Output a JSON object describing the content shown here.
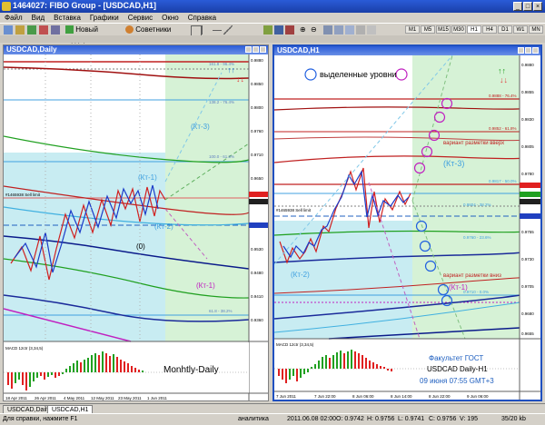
{
  "app": {
    "title": "1464027: FIBO Group - [USDCAD,H1]"
  },
  "menu": [
    "Файл",
    "Вид",
    "Вставка",
    "Графики",
    "Сервис",
    "Окно",
    "Справка"
  ],
  "toolbar": {
    "new_order": "Новый Ордер",
    "advisors": "Советники",
    "timeframes": [
      "M1",
      "M5",
      "M15",
      "M30",
      "H1",
      "H4",
      "D1",
      "W1",
      "MN"
    ]
  },
  "window_left": {
    "title": "USDCAD,Daily",
    "price_labels": [
      "0.9880",
      "0.9850",
      "0.9800",
      "0.9760",
      "0.9710",
      "0.9650",
      "0.9620",
      "0.9560",
      "0.9530",
      "0.9480",
      "0.9410",
      "0.9360"
    ],
    "annotations": {
      "kt3": "(Кт-3)",
      "kt1": "(Кт-1)",
      "kt2": "(Кт-2)",
      "zero": "(0)",
      "kt1b": "(Кт-1)",
      "sell": "#1465938 Sell limit"
    },
    "fib_labels": [
      "161.8 - 96.4%",
      "138.2 - 76.4%",
      "100.0 - 61.8%",
      "61.8 - 38.2%"
    ],
    "time_labels": [
      "18 Apr 2011",
      "26 Apr 2011",
      "4 May 2011",
      "12 May 2011",
      "23 May 2011",
      "1 Jun 2011"
    ],
    "macd_label": "MACD 12ctr (3,34,5)",
    "caption": "Monhtly-Daily"
  },
  "window_right": {
    "title": "USDCAD,H1",
    "price_labels": [
      "0.9880",
      "0.9855",
      "0.9830",
      "0.9805",
      "0.9780",
      "0.9755",
      "0.9730",
      "0.9705",
      "0.9680",
      "0.9655"
    ],
    "annotations": {
      "legend": "выделенные уровни",
      "kt3": "(Кт-3)",
      "up": "вариант разметки вверх",
      "down": "вариант разметки вниз",
      "kt2": "(Кт-2)",
      "kt1": "(Кт-1)",
      "sell": "#1465938 Sell limit"
    },
    "fib_labels": [
      "0.9888 - 76.4%",
      "0.9852 - 61.8%",
      "0.9817 - 50.0%",
      "0.9804 - 38.2%",
      "0.9760 - 23.6%",
      "0.9710 - 0.0%"
    ],
    "time_labels": [
      "7 Jun 2011",
      "7 Jun 22:00",
      "8 Jun 06:00",
      "8 Jun 14:00",
      "8 Jun 22:00",
      "9 Jun 06:00"
    ],
    "macd_label": "MACD 12ctr (3,34,5)",
    "caption_lines": [
      "Факультет ГОСТ",
      "USDCAD Daily-H1",
      "09 июня 07:55 GMT+3"
    ]
  },
  "bottom_tabs": [
    "USDCAD,Daily",
    "USDCAD,H1"
  ],
  "status": {
    "help": "Для справки, нажмите F1",
    "profile": "аналитика",
    "datetime": "2011.06.08 02:00",
    "o": "O: 0.9742",
    "h": "H: 0.9756",
    "l": "L: 0.9741",
    "c": "C: 0.9756",
    "v": "V: 195",
    "traffic": "35/20 kb"
  }
}
